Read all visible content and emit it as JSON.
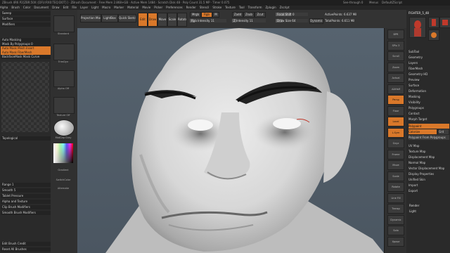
{
  "titlebar": {
    "text": "ZBrush 4R6 P2[ZBR:50X:{DFU:RX0:TEQ:DOT}] · ZBrush Document · Free Mem 2.868+GB · Active Mem 1484 · Scratch Disk 48 · Poly Count 31.5 MP · Timer 0.075",
    "see_through": "See-through 0",
    "menus": "Menus",
    "default_zscript": "DefaultZScript"
  },
  "menubar": [
    "Alpha",
    "Brush",
    "Color",
    "Document",
    "Draw",
    "Edit",
    "File",
    "Layer",
    "Light",
    "Macro",
    "Marker",
    "Material",
    "Movie",
    "Picker",
    "Preferences",
    "Render",
    "Stencil",
    "Stroke",
    "Texture",
    "Tool",
    "Transform",
    "Zplugin",
    "Zscript"
  ],
  "left_panel": {
    "items": [
      "Sweep",
      "Surface",
      "Modifiers",
      "Auto Masking",
      "Mask By Polygroups 0",
      "Auto Mask Mesh Insert",
      "Auto Mask FiberMesh",
      "BackfaceMask Mask Curve",
      "Topological",
      "Range 1",
      "Smooth 5",
      "Tablet Pressure",
      "Alpha and Texture",
      "Clip Brush Modifiers",
      "Smooth Brush Modifiers",
      "Edit Brush Credit",
      "Reset All Brushes"
    ],
    "orange_items": [
      "Auto Mask Mesh Insert",
      "Auto Mask FiberMesh"
    ]
  },
  "tool_column": {
    "labels": [
      "Standard",
      "TrimDyn",
      "Alpha Off",
      "Texture Off",
      "MatCap Gray",
      "Gradient",
      "SwitchColor",
      "Alternate"
    ]
  },
  "top_shelf": {
    "buttons": [
      "Projection Master",
      "LightBox",
      "Quick Sketch",
      "Edit",
      "Draw",
      "Move",
      "Scale",
      "Rotate"
    ],
    "mrgb": "Mrgb",
    "rgb": "Rgb",
    "m": "M",
    "zadd": "Zadd",
    "zsub": "Zsub",
    "zcut": "Zcut",
    "rgb_intensity_label": "Rgb Intensity",
    "rgb_intensity": "11",
    "z_intensity_label": "Z Intensity",
    "z_intensity": "11",
    "focal_shift_label": "Focal Shift",
    "focal_shift": "0",
    "draw_size_label": "Draw Size",
    "draw_size": "64",
    "dynamic": "Dynamic",
    "active_points": "ActivePoints: 6.637 Mil",
    "total_points": "TotalPoints: 6.611 Mil"
  },
  "right_icons": [
    "BPR",
    "SPix 3",
    "Scroll",
    "Zoom",
    "Actual",
    "AAHalf",
    "Persp",
    "Floor",
    "Local",
    "L.Sym",
    "Gxyz",
    "Frame",
    "Move",
    "Scale",
    "Rotate",
    "Line Fill",
    "Transp",
    "Dynamic",
    "Solo",
    "Xpose"
  ],
  "palette": {
    "tool_name": "FIGHTER_5_48",
    "items": [
      "SubTool",
      "Geometry",
      "Layers",
      "FiberMesh",
      "Geometry HD",
      "Preview",
      "Surface",
      "Deformation",
      "Masking",
      "Visibility",
      "Polygroups",
      "Contact",
      "Morph Target",
      "Polypaint",
      "Colorize",
      "Grd",
      "Polypaint From Polygroups",
      "UV Map",
      "Texture Map",
      "Displacement Map",
      "Normal Map",
      "Vector Displacement Map",
      "Display Properties",
      "Unified Skin",
      "Import",
      "Export"
    ],
    "head_items": [
      "Polypaint"
    ],
    "render": "Render",
    "light": "Light"
  },
  "colors": {
    "accent": "#d9782a",
    "bg": "#2b2b2b",
    "viewport": "#56636f"
  }
}
